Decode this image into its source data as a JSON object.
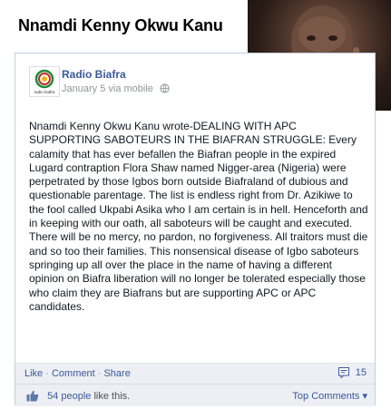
{
  "headline": "Nnamdi Kenny Okwu Kanu",
  "post": {
    "page_name": "Radio Biafra",
    "date": "January 5",
    "source": "via mobile",
    "logo_text": "radio biafra",
    "text": "Nnamdi Kenny Okwu Kanu wrote-DEALING WITH APC SUPPORTING SABOTEURS IN THE BIAFRAN STRUGGLE: Every calamity that has ever befallen the Biafran people in the expired Lugard contraption Flora Shaw named Nigger-area (Nigeria) were perpetrated by those Igbos born outside Biafraland of dubious and questionable parentage. The list is endless right from Dr. Azikiwe to the fool called Ukpabi Asika who I am certain is in hell. Henceforth and in keeping with our oath, all saboteurs will be caught and executed. There will be no mercy, no pardon, no forgiveness. All traitors must die and so too their families. This nonsensical disease of Igbo saboteurs springing up all over the place in the name of having a different opinion on Biafra liberation will no longer be tolerated especially those who claim they are Biafrans but are supporting APC or APC candidates."
  },
  "actions": {
    "like": "Like",
    "separator": "·",
    "comment": "Comment",
    "share": "Share",
    "comment_count": "15"
  },
  "likes": {
    "people": "54 people",
    "suffix": "like this.",
    "top_comments": "Top Comments"
  },
  "colors": {
    "link": "#3b5998",
    "bar_bg": "#edeff4",
    "border": "#c4cde0"
  }
}
